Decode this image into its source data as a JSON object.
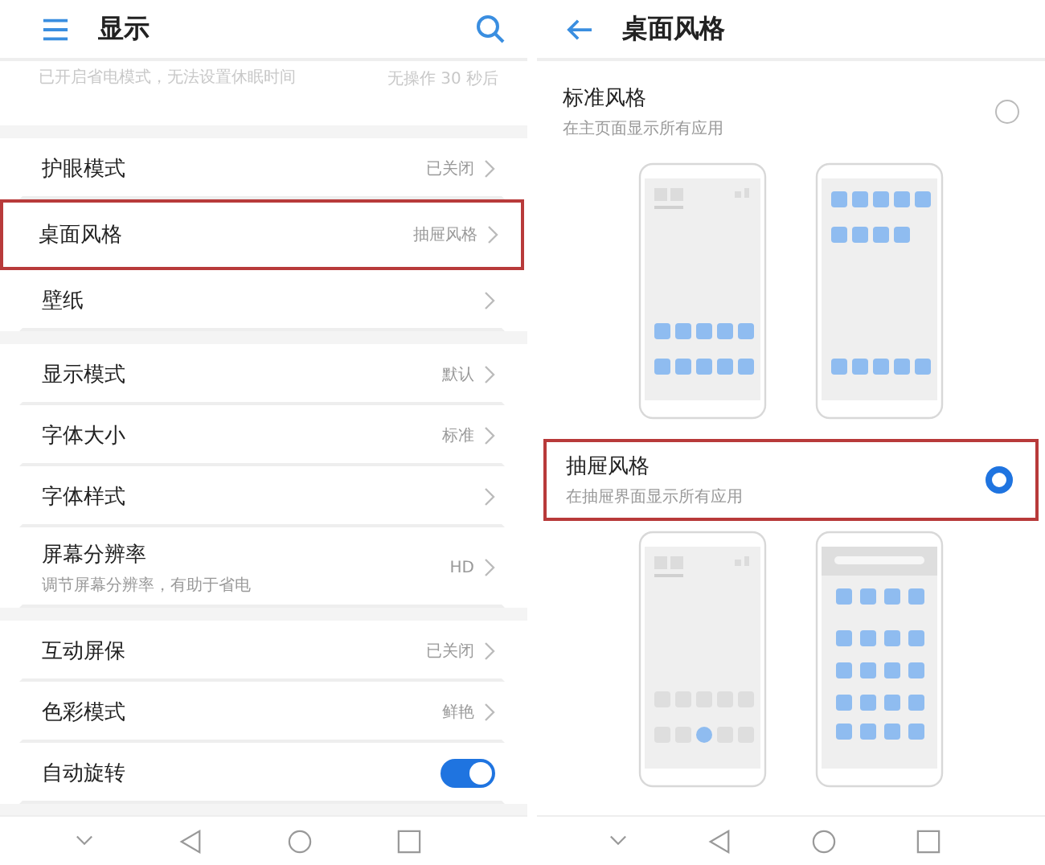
{
  "left_screen": {
    "title": "显示",
    "notice": {
      "text": "已开启省电模式，无法设置休眠时间",
      "value": "无操作 30 秒后"
    },
    "groups": [
      {
        "items": [
          {
            "kind": "link",
            "label": "护眼模式",
            "value": "已关闭",
            "highlighted": false
          },
          {
            "kind": "link",
            "label": "桌面风格",
            "value": "抽屉风格",
            "highlighted": true
          },
          {
            "kind": "link",
            "label": "壁纸",
            "highlighted": false
          }
        ]
      },
      {
        "items": [
          {
            "kind": "link",
            "label": "显示模式",
            "value": "默认",
            "highlighted": false
          },
          {
            "kind": "link",
            "label": "字体大小",
            "value": "标准",
            "highlighted": false
          },
          {
            "kind": "link",
            "label": "字体样式",
            "highlighted": false
          },
          {
            "kind": "link",
            "label": "屏幕分辨率",
            "subtitle": "调节屏幕分辨率，有助于省电",
            "value": "HD",
            "highlighted": false
          }
        ]
      },
      {
        "items": [
          {
            "kind": "link",
            "label": "互动屏保",
            "value": "已关闭",
            "highlighted": false
          },
          {
            "kind": "link",
            "label": "色彩模式",
            "value": "鲜艳",
            "highlighted": false
          },
          {
            "kind": "toggle",
            "label": "自动旋转",
            "on": true,
            "highlighted": false
          }
        ]
      }
    ]
  },
  "right_screen": {
    "title": "桌面风格",
    "options": [
      {
        "title": "标准风格",
        "subtitle": "在主页面显示所有应用",
        "selected": false,
        "highlighted": false,
        "previews": [
          {
            "kind": "home_docked"
          },
          {
            "kind": "home_grid"
          }
        ]
      },
      {
        "title": "抽屉风格",
        "subtitle": "在抽屉界面显示所有应用",
        "selected": true,
        "highlighted": true,
        "previews": [
          {
            "kind": "drawer_home"
          },
          {
            "kind": "drawer_apps"
          }
        ]
      }
    ]
  }
}
